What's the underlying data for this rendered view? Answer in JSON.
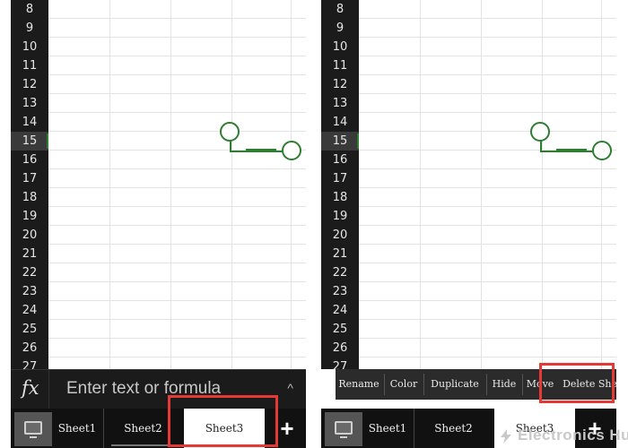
{
  "left_panel": {
    "row_numbers": [
      "8",
      "9",
      "10",
      "11",
      "12",
      "13",
      "14",
      "15",
      "16",
      "17",
      "18",
      "19",
      "20",
      "21",
      "22",
      "23",
      "24",
      "25",
      "26",
      "27"
    ],
    "selected_row": "15",
    "formula_bar": {
      "fx_label": "fx",
      "placeholder": "Enter text or formula",
      "chevron": "^"
    },
    "tabs": [
      "Sheet1",
      "Sheet2",
      "Sheet3"
    ],
    "active_tab": "Sheet3",
    "add_sheet_label": "+"
  },
  "right_panel": {
    "row_numbers": [
      "8",
      "9",
      "10",
      "11",
      "12",
      "13",
      "14",
      "15",
      "16",
      "17",
      "18",
      "19",
      "20",
      "21",
      "22",
      "23",
      "24",
      "25",
      "26",
      "27"
    ],
    "selected_row": "15",
    "context_menu": [
      "Rename",
      "Color",
      "Duplicate",
      "Hide",
      "Move",
      "Delete Sheet"
    ],
    "tabs": [
      "Sheet1",
      "Sheet2",
      "Sheet3"
    ],
    "active_tab": "Sheet3",
    "add_sheet_label": "+"
  },
  "colors": {
    "selection_accent": "#2e7d32",
    "highlight": "#e53935",
    "dark_chrome": "#1b1b1b"
  },
  "icons": {
    "formula": "fx-icon",
    "sheet_view": "monitor-icon",
    "add": "plus-icon",
    "collapse": "chevron-up-icon"
  },
  "watermark": {
    "text": "Electronics Hub"
  }
}
